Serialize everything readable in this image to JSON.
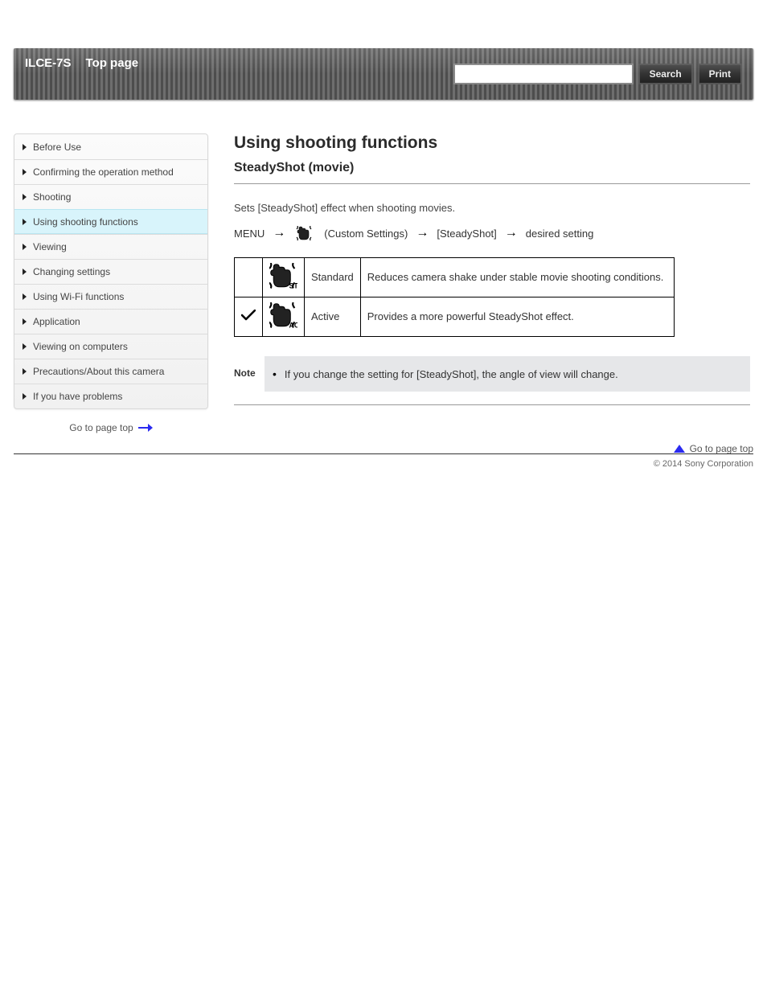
{
  "header": {
    "product": "ILCE-7S",
    "topnav": [
      "Top page"
    ],
    "search_btn": "Search",
    "print_btn": "Print"
  },
  "sidebar": {
    "items": [
      {
        "label": "Before Use"
      },
      {
        "label": "Confirming the operation method"
      },
      {
        "label": "Shooting"
      },
      {
        "label": "Using shooting functions"
      },
      {
        "label": "Viewing"
      },
      {
        "label": "Changing settings"
      },
      {
        "label": "Using Wi-Fi functions"
      },
      {
        "label": "Application"
      },
      {
        "label": "Viewing on computers"
      },
      {
        "label": "Precautions/About this camera"
      },
      {
        "label": "If you have problems"
      }
    ],
    "active_index": 3,
    "goto_label": "Go to page top"
  },
  "main": {
    "title": "Using shooting functions",
    "subtitle": "SteadyShot (movie)",
    "desc": "Sets [SteadyShot] effect when shooting movies.",
    "menu_path": {
      "step1": "MENU",
      "arrow1": "→",
      "step2_text": "(Custom Settings)",
      "arrow2": "→",
      "step3": "[SteadyShot]",
      "arrow3": "→",
      "step4": "desired setting"
    },
    "table": [
      {
        "checked": false,
        "mode": "STD",
        "label": "Standard",
        "desc": "Reduces camera shake under stable movie shooting conditions."
      },
      {
        "checked": true,
        "mode": "ACT",
        "label": "Active",
        "desc": "Provides a more powerful SteadyShot effect."
      }
    ],
    "note_heading": "Note",
    "notes": [
      "If you change the setting for [SteadyShot], the angle of view will change."
    ]
  },
  "footer": {
    "goto_top": "Go to page top",
    "copyright": "© 2014 Sony Corporation"
  }
}
